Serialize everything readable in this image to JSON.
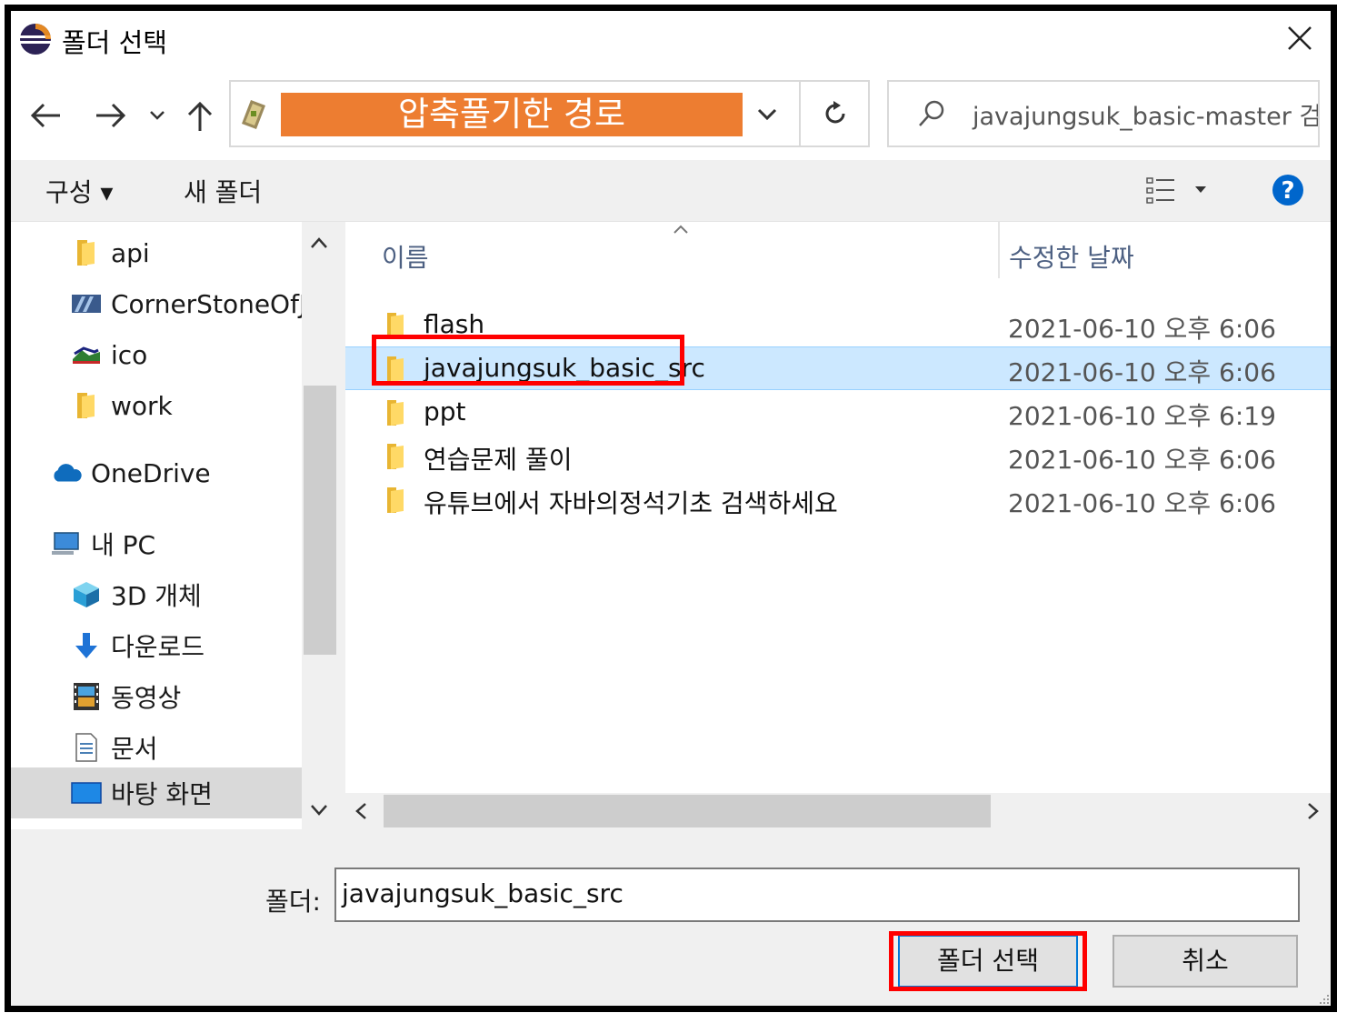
{
  "window": {
    "title": "폴더 선택",
    "close_icon": "close-icon"
  },
  "nav": {
    "back_icon": "arrow-left-icon",
    "forward_icon": "arrow-right-icon",
    "recent_icon": "chevron-down-icon",
    "up_icon": "arrow-up-icon",
    "address_text": "압축풀기한 경로",
    "refresh_icon": "refresh-icon",
    "search_placeholder": "javajungsuk_basic-master 검..."
  },
  "toolbar": {
    "organize_label": "구성 ▾",
    "new_folder_label": "새 폴더",
    "view_icon": "view-options-icon",
    "help_icon": "help-icon"
  },
  "sidebar": {
    "items": [
      {
        "label": "api",
        "icon": "folder-icon"
      },
      {
        "label": "CornerStoneOfJ/",
        "icon": "folder-shortcut-icon"
      },
      {
        "label": "ico",
        "icon": "folder-shortcut-icon"
      },
      {
        "label": "work",
        "icon": "folder-icon"
      },
      {
        "label": "OneDrive",
        "icon": "cloud-icon"
      },
      {
        "label": "내 PC",
        "icon": "pc-icon"
      },
      {
        "label": "3D 개체",
        "icon": "cube-icon"
      },
      {
        "label": "다운로드",
        "icon": "download-icon"
      },
      {
        "label": "동영상",
        "icon": "video-icon"
      },
      {
        "label": "문서",
        "icon": "document-icon"
      },
      {
        "label": "바탕 화면",
        "icon": "desktop-icon"
      }
    ]
  },
  "files": {
    "columns": {
      "name": "이름",
      "modified": "수정한 날짜"
    },
    "rows": [
      {
        "name": "flash",
        "modified": "2021-06-10 오후 6:06"
      },
      {
        "name": "javajungsuk_basic_src",
        "modified": "2021-06-10 오후 6:06",
        "selected": true
      },
      {
        "name": "ppt",
        "modified": "2021-06-10 오후 6:19"
      },
      {
        "name": "연습문제 풀이",
        "modified": "2021-06-10 오후 6:06"
      },
      {
        "name": "유튜브에서 자바의정석기초 검색하세요",
        "modified": "2021-06-10 오후 6:06"
      }
    ]
  },
  "footer": {
    "folder_label": "폴더:",
    "folder_value": "javajungsuk_basic_src",
    "select_button": "폴더 선택",
    "cancel_button": "취소"
  },
  "colors": {
    "address_highlight": "#ed7d31",
    "selection": "#cce8ff",
    "annotation": "#ff0000",
    "help_blue": "#0066cc"
  }
}
